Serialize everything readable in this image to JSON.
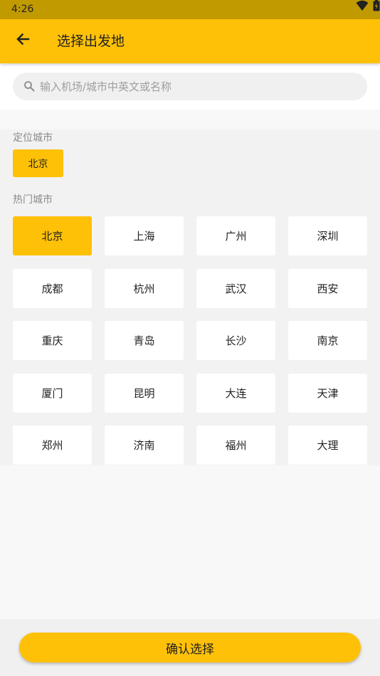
{
  "status_bar": {
    "time": "4:26",
    "icons": [
      "wifi-icon",
      "battery-icon"
    ]
  },
  "app_bar": {
    "title": "选择出发地",
    "back_icon": "arrow-left-icon"
  },
  "search": {
    "placeholder": "输入机场/城市中英文或名称",
    "value": "",
    "icon": "search-icon"
  },
  "located": {
    "label": "定位城市",
    "city": "北京"
  },
  "hot": {
    "label": "热门城市",
    "selected": "北京",
    "rows": [
      [
        "北京",
        "上海",
        "广州",
        "深圳"
      ],
      [
        "成都",
        "杭州",
        "武汉",
        "西安"
      ],
      [
        "重庆",
        "青岛",
        "长沙",
        "南京"
      ],
      [
        "厦门",
        "昆明",
        "大连",
        "天津"
      ],
      [
        "郑州",
        "济南",
        "福州",
        "大理"
      ]
    ]
  },
  "confirm_label": "确认选择",
  "colors": {
    "accent": "#ffc107",
    "status_bar": "#c19a00",
    "text": "#222222",
    "muted": "#8a8a8a"
  }
}
